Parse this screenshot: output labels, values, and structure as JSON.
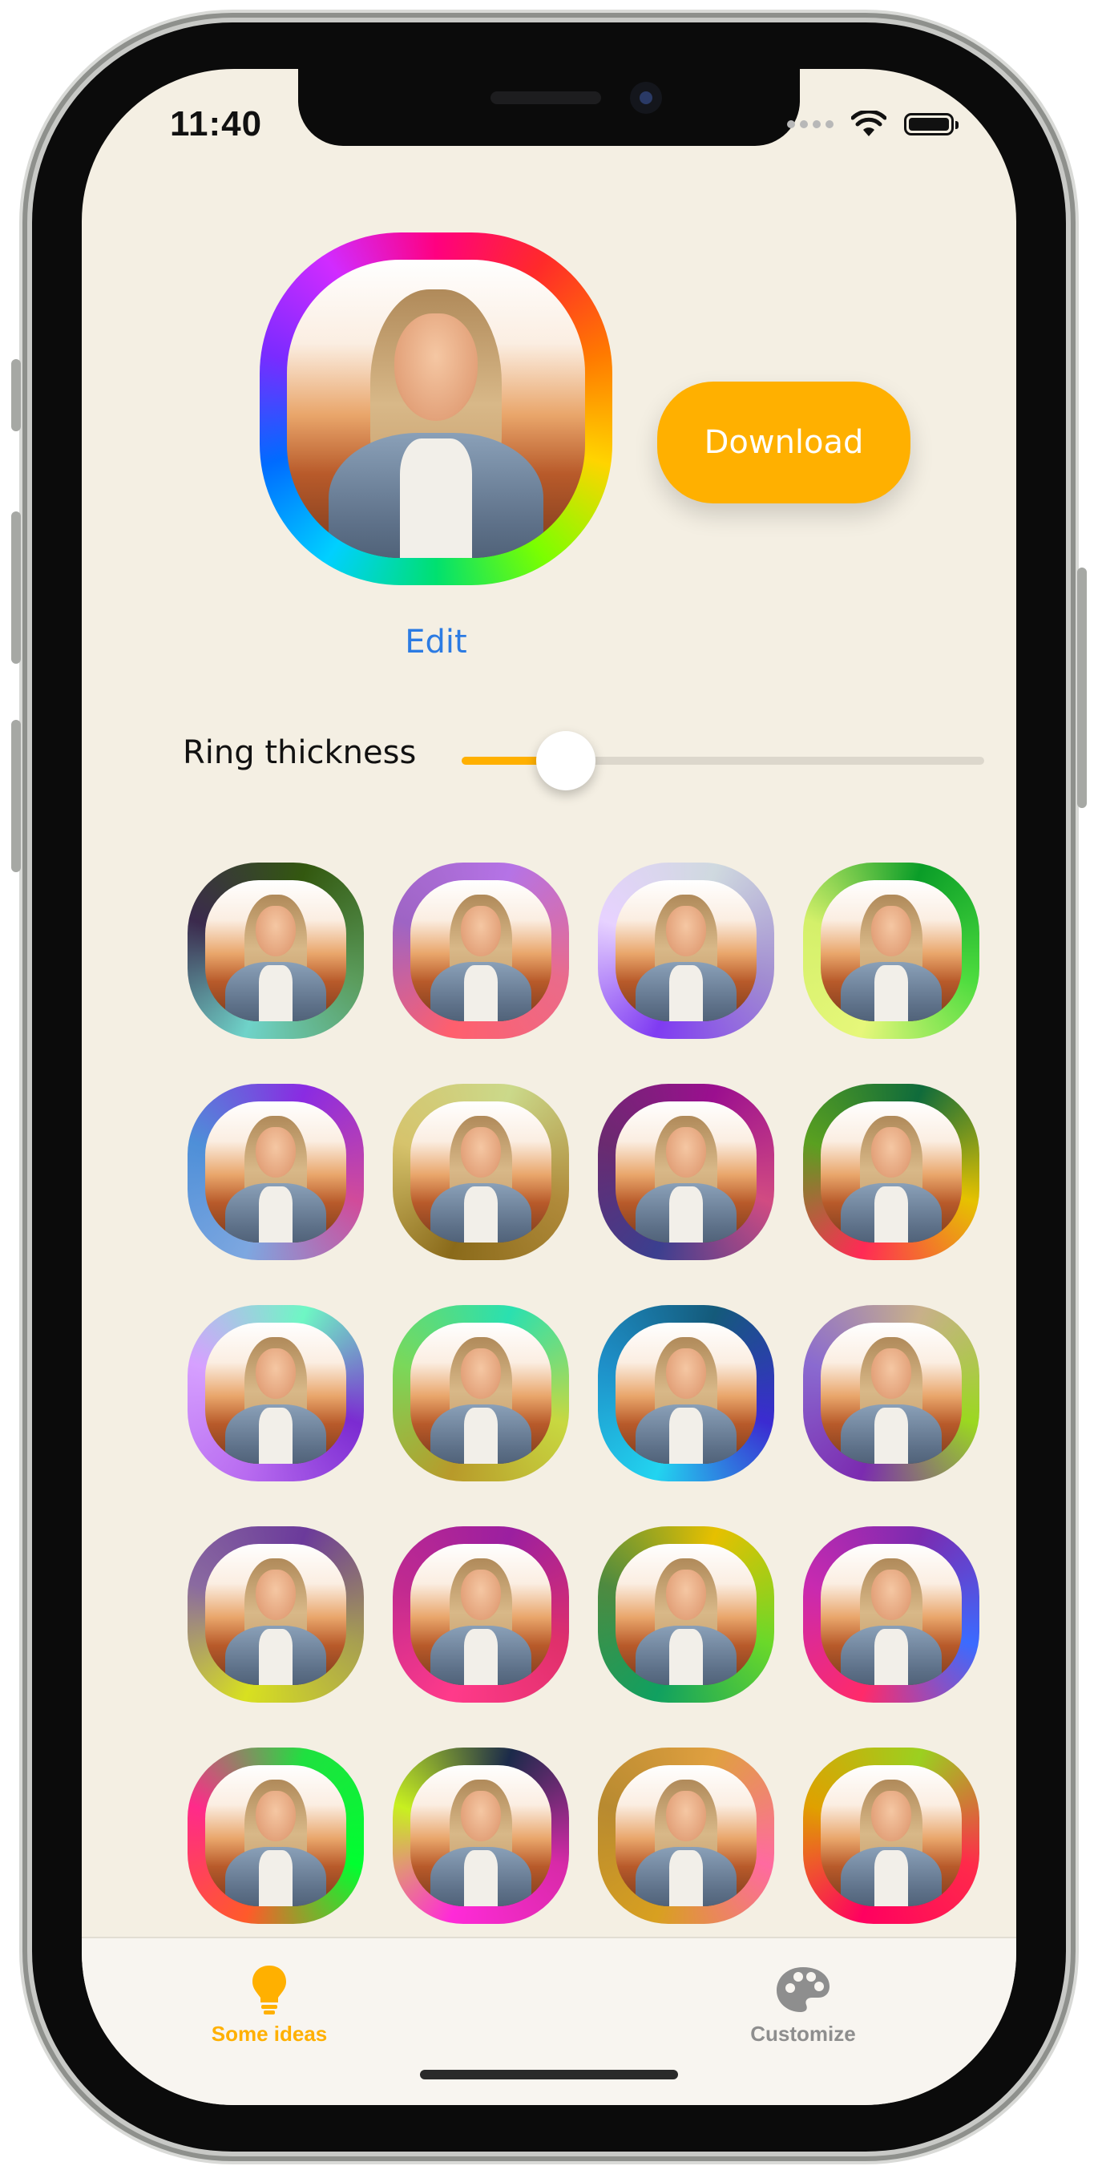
{
  "status_bar": {
    "time": "11:40"
  },
  "editor": {
    "download_label": "Download",
    "edit_label": "Edit",
    "slider_label": "Ring thickness",
    "ring_thickness": 0.2,
    "accent_color": "#ffb000",
    "link_color": "#2b7be3",
    "background_color": "#f4efe3"
  },
  "ideas": [
    {
      "gradient": [
        "#33580f",
        "#5b9c5c",
        "#6fd3c9",
        "#3b2a4d"
      ]
    },
    {
      "gradient": [
        "#b573e6",
        "#ea6b8a",
        "#ff5f6d",
        "#9e64c4"
      ]
    },
    {
      "gradient": [
        "#cfd9df",
        "#a18cd1",
        "#7f3bf2",
        "#e7d2ff"
      ]
    },
    {
      "gradient": [
        "#0a9d28",
        "#4ddc3e",
        "#e6f77a",
        "#d4f06a"
      ]
    },
    {
      "gradient": [
        "#8a2be2",
        "#d14b9a",
        "#7da7e0",
        "#4e8fd8"
      ]
    },
    {
      "gradient": [
        "#cbd98a",
        "#b08a3a",
        "#8a6a1a",
        "#d6c36c"
      ]
    },
    {
      "gradient": [
        "#9b0f8f",
        "#d14b82",
        "#3b3f8f",
        "#6b2a70"
      ]
    },
    {
      "gradient": [
        "#0f6b3b",
        "#e6c200",
        "#ff2a55",
        "#5aa020"
      ]
    },
    {
      "gradient": [
        "#6ef7c4",
        "#7b2bd1",
        "#b86bf0",
        "#d6a0ff"
      ]
    },
    {
      "gradient": [
        "#2ae0b0",
        "#c8d840",
        "#b89a2a",
        "#7ad85a"
      ]
    },
    {
      "gradient": [
        "#145a7a",
        "#3b2bd1",
        "#22d4f0",
        "#1e8fc8"
      ]
    },
    {
      "gradient": [
        "#c8b08a",
        "#9bd820",
        "#7b2bb0",
        "#8a6ad0"
      ]
    },
    {
      "gradient": [
        "#6b3a9b",
        "#a8a050",
        "#d8e020",
        "#8a6aa0"
      ]
    },
    {
      "gradient": [
        "#9b1fa0",
        "#e0306b",
        "#ff3a8a",
        "#c02a90"
      ]
    },
    {
      "gradient": [
        "#e6c000",
        "#6ad82a",
        "#10a060",
        "#4e8a40"
      ]
    },
    {
      "gradient": [
        "#7b2bb0",
        "#3b6bff",
        "#ff2a6a",
        "#c82ab0"
      ]
    },
    {
      "gradient": [
        "#1fe040",
        "#00ff30",
        "#ff5a2a",
        "#ff2a8a"
      ]
    },
    {
      "gradient": [
        "#1b2a4a",
        "#d82aa8",
        "#ff2ad8",
        "#c8f020"
      ]
    },
    {
      "gradient": [
        "#e0a040",
        "#ff6aa0",
        "#d8a020",
        "#b88a30"
      ]
    },
    {
      "gradient": [
        "#9bd020",
        "#ff2a4a",
        "#ff0060",
        "#e0a000"
      ]
    }
  ],
  "tabbar": {
    "tabs": [
      {
        "label": "Some ideas",
        "icon": "lightbulb-icon",
        "active": true,
        "color": "#ffb000"
      },
      {
        "label": "Customize",
        "icon": "palette-icon",
        "active": false,
        "color": "#8e8e8e"
      }
    ]
  }
}
